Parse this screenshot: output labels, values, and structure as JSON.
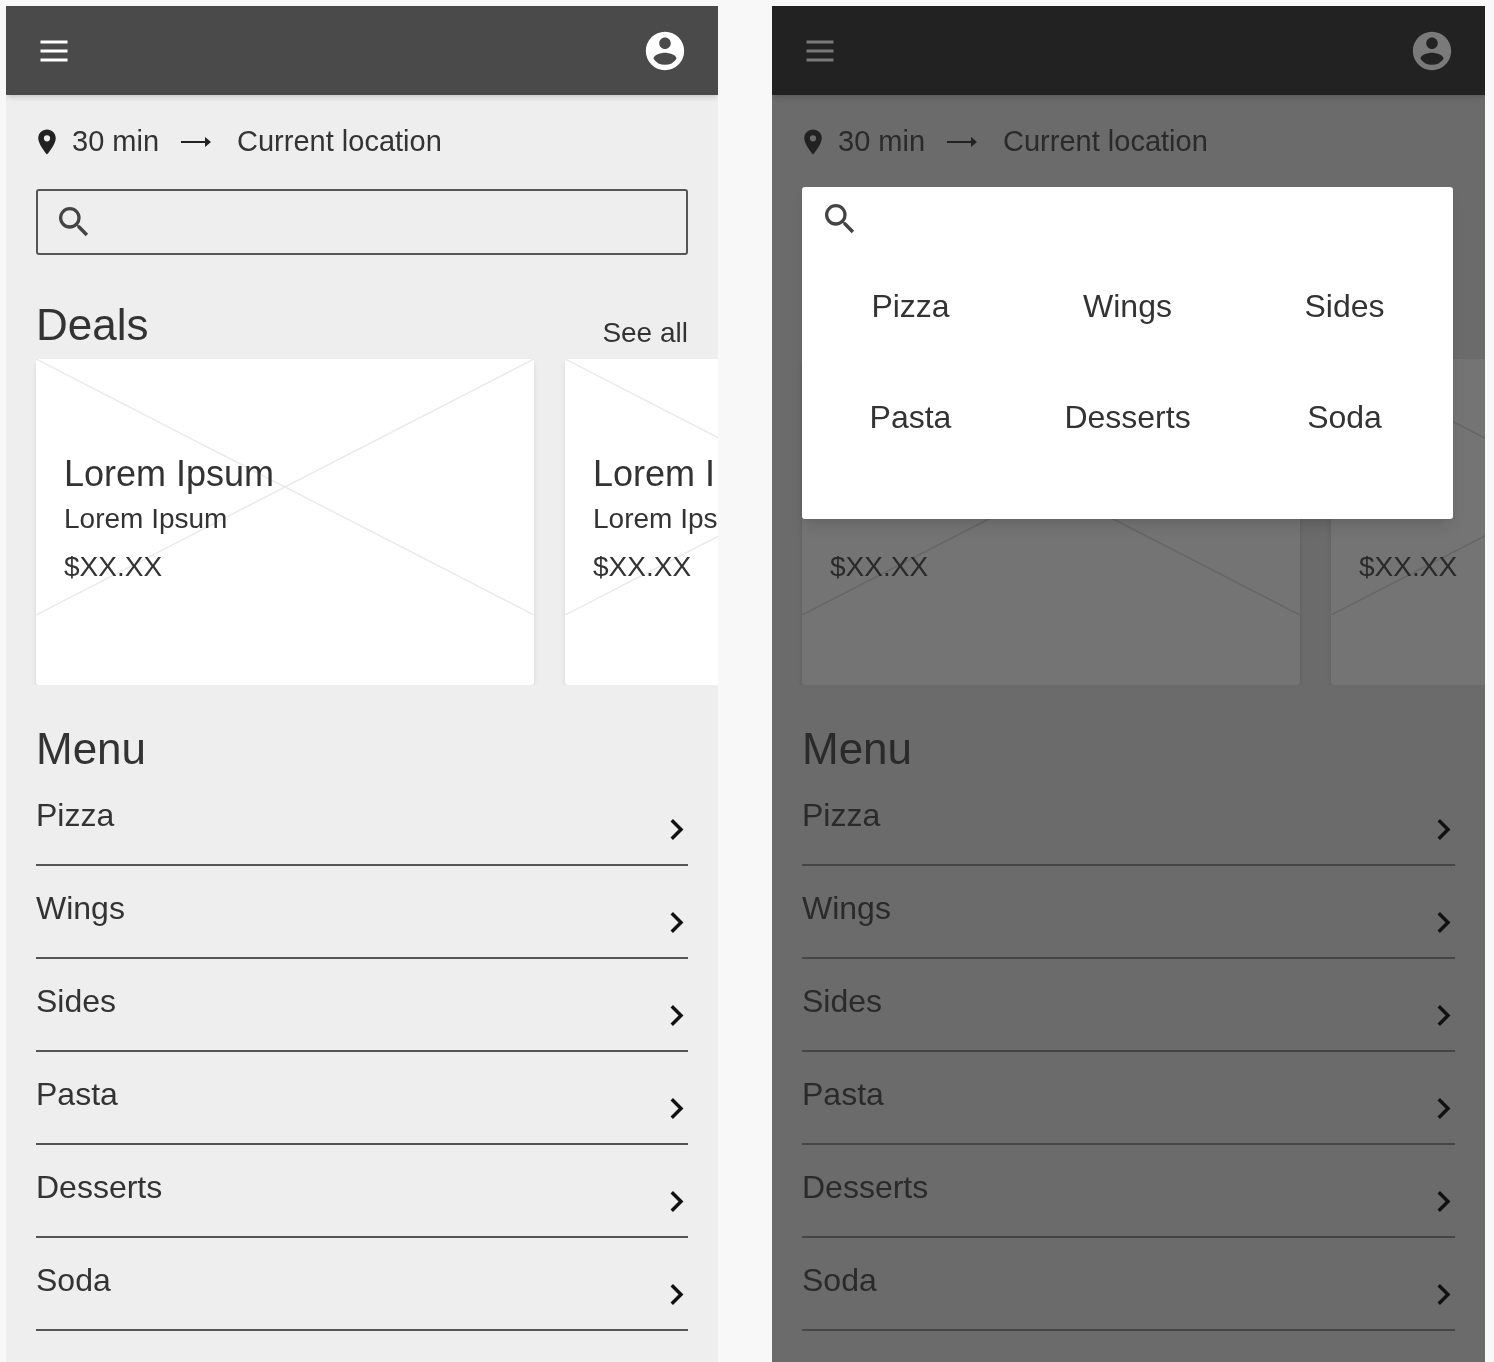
{
  "screens": [
    {
      "kind": "default",
      "dimmed": false,
      "location": {
        "time": "30 min",
        "destination": "Current location"
      },
      "deals": {
        "title": "Deals",
        "see_all": "See all",
        "cards": [
          {
            "title": "Lorem Ipsum",
            "subtitle": "Lorem Ipsum",
            "price": "$XX.XX"
          },
          {
            "title": "Lorem I",
            "subtitle": "Lorem Ips",
            "price": "$XX.XX"
          }
        ]
      },
      "menu": {
        "title": "Menu",
        "items": [
          "Pizza",
          "Wings",
          "Sides",
          "Pasta",
          "Desserts",
          "Soda"
        ]
      }
    },
    {
      "kind": "search_open",
      "dimmed": true,
      "location": {
        "time": "30 min",
        "destination": "Current location"
      },
      "deals": {
        "cards": [
          {
            "price": "$XX.XX"
          },
          {
            "price": "$XX.XX"
          }
        ]
      },
      "search_popup": {
        "categories": [
          "Pizza",
          "Wings",
          "Sides",
          "Pasta",
          "Desserts",
          "Soda"
        ]
      },
      "menu": {
        "title": "Menu",
        "items": [
          "Pizza",
          "Wings",
          "Sides",
          "Pasta",
          "Desserts",
          "Soda"
        ]
      }
    }
  ]
}
